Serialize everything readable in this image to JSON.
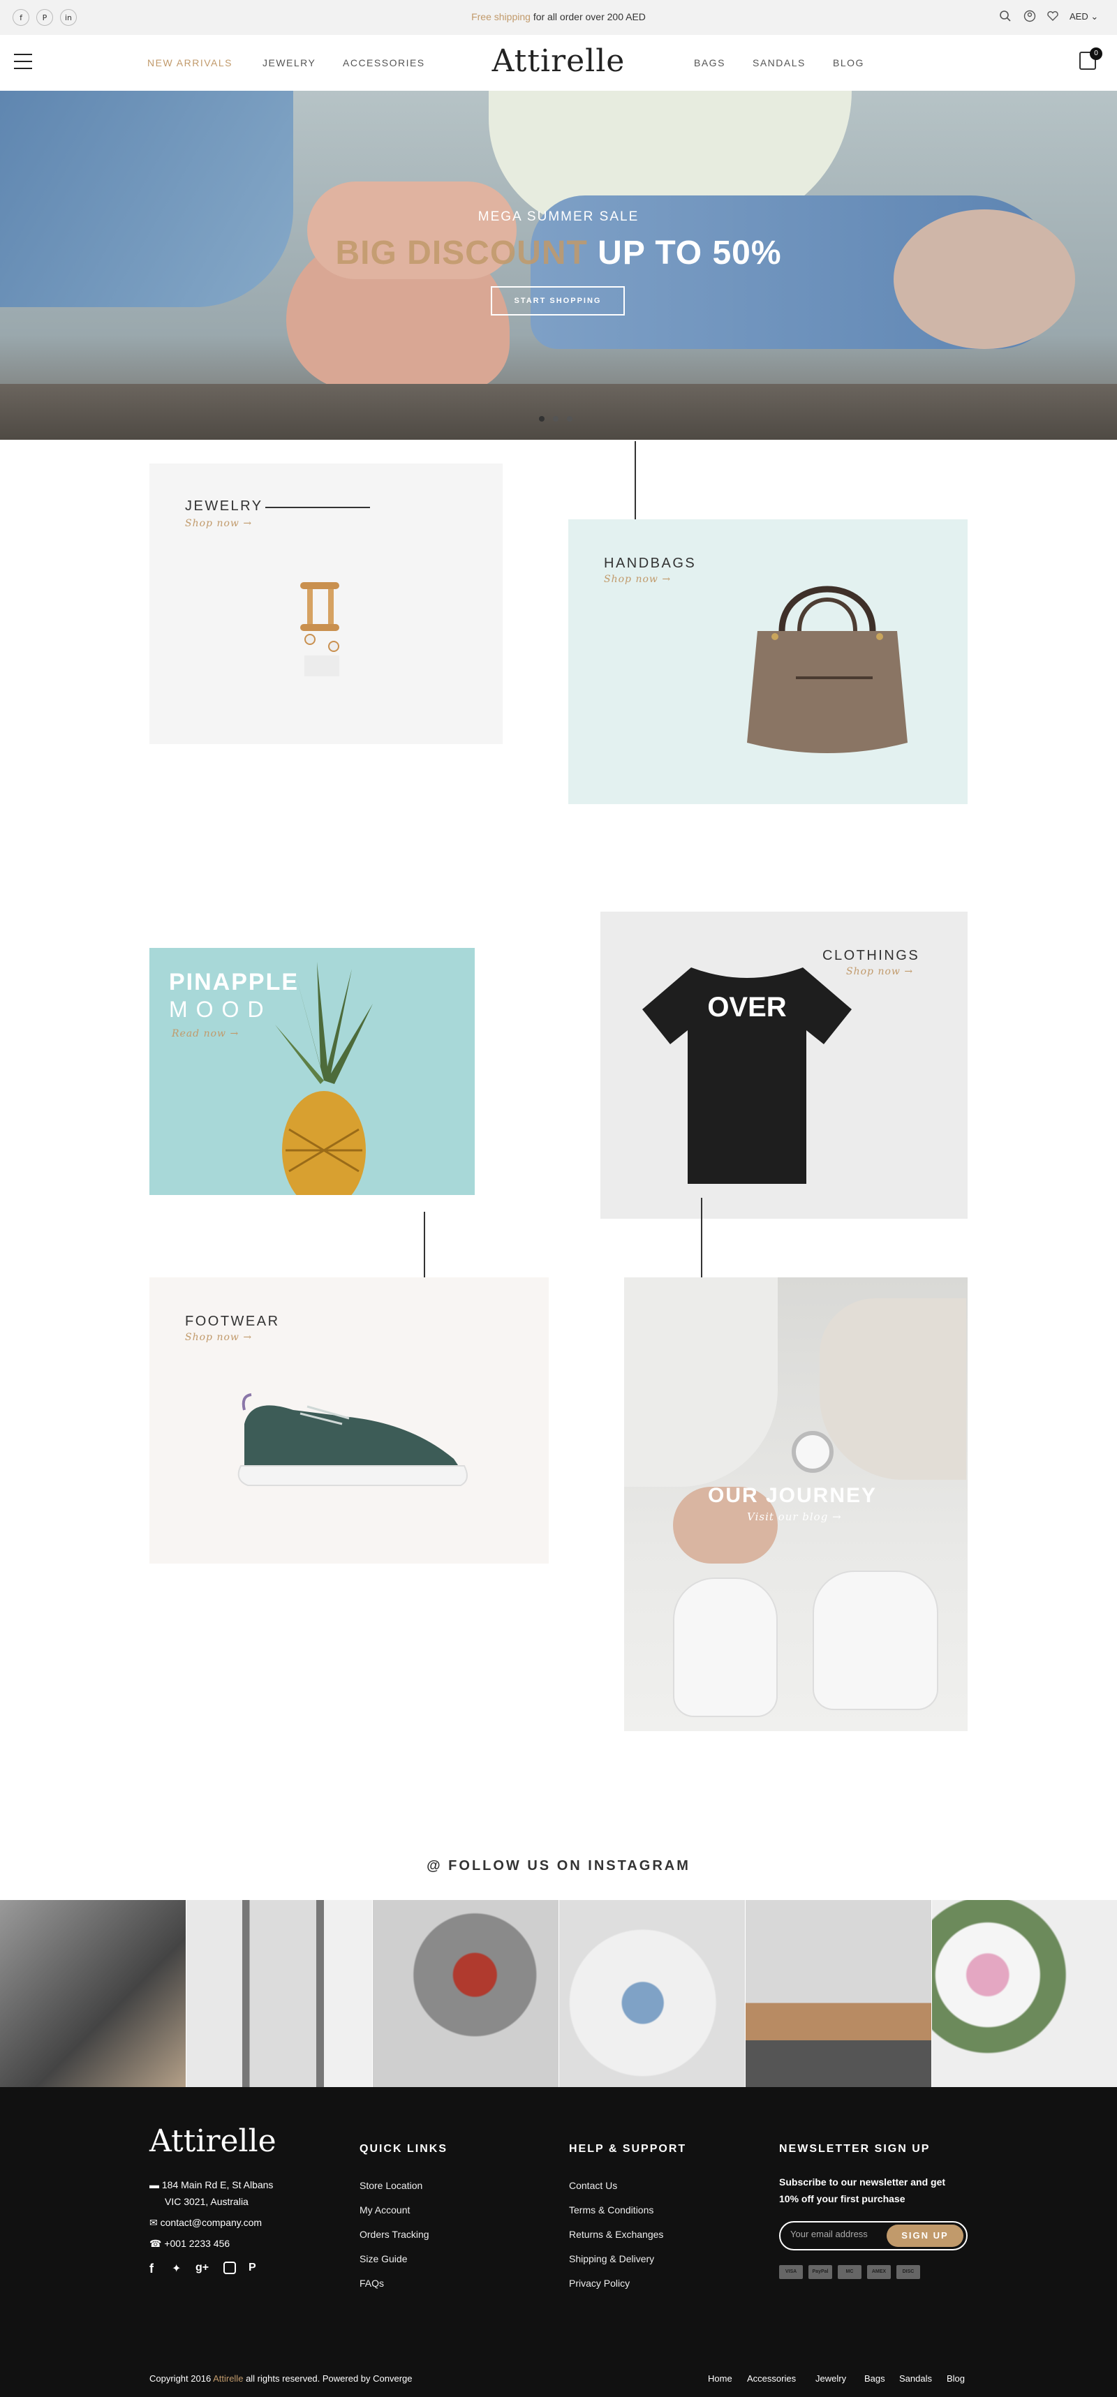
{
  "topbar": {
    "social": [
      "f",
      "P",
      "in"
    ],
    "promo_highlight": "Free shipping",
    "promo_rest": "for all order over 200 AED",
    "currency": "AED"
  },
  "header": {
    "nav_left": [
      "NEW ARRIVALS",
      "JEWELRY",
      "ACCESSORIES"
    ],
    "logo": "Attirelle",
    "nav_right": [
      "BAGS",
      "SANDALS",
      "BLOG"
    ],
    "cart_count": "0"
  },
  "hero": {
    "subtitle": "MEGA SUMMER SALE",
    "title_accent": "BIG DISCOUNT",
    "title_rest": "UP TO 50%",
    "button": "START SHOPPING"
  },
  "categories": {
    "jewelry": {
      "title": "JEWELRY",
      "link": "Shop now →"
    },
    "handbags": {
      "title": "HANDBAGS",
      "link": "Shop now →"
    },
    "pineapple": {
      "title": "PINAPPLE",
      "title2": "MOOD",
      "link": "Read now →"
    },
    "clothings": {
      "title": "CLOTHINGS",
      "link": "Shop now →",
      "shirt_text": "OVER"
    },
    "footwear": {
      "title": "FOOTWEAR",
      "link": "Shop now →"
    },
    "journey": {
      "title": "OUR JOURNEY",
      "link": "Visit our blog →"
    }
  },
  "instagram": {
    "title": "@ FOLLOW US ON INSTAGRAM"
  },
  "footer": {
    "logo": "Attirelle",
    "address1": "184 Main Rd E, St Albans",
    "address2": "VIC 3021, Australia",
    "email": "contact@company.com",
    "phone": "+001 2233 456",
    "quick_links_title": "QUICK LINKS",
    "quick_links": [
      "Store Location",
      "My Account",
      "Orders Tracking",
      "Size Guide",
      "FAQs"
    ],
    "help_title": "HELP & SUPPORT",
    "help_links": [
      "Contact Us",
      "Terms & Conditions",
      "Returns & Exchanges",
      "Shipping & Delivery",
      "Privacy Policy"
    ],
    "newsletter_title": "NEWSLETTER SIGN UP",
    "newsletter_text1": "Subscribe to our newsletter and get",
    "newsletter_text2": "10% off your first purchase",
    "email_placeholder": "Your email address",
    "signup_button": "SIGN UP",
    "payments": [
      "VISA",
      "PayPal",
      "MC",
      "AMEX",
      "DISC"
    ],
    "copyright_pre": "Copyright 2016",
    "copyright_brand": "Attirelle",
    "copyright_post": "all rights reserved. Powered by Converge",
    "bottom_links": [
      "Home",
      "Accessories",
      "Jewelry",
      "Bags",
      "Sandals",
      "Blog"
    ]
  }
}
